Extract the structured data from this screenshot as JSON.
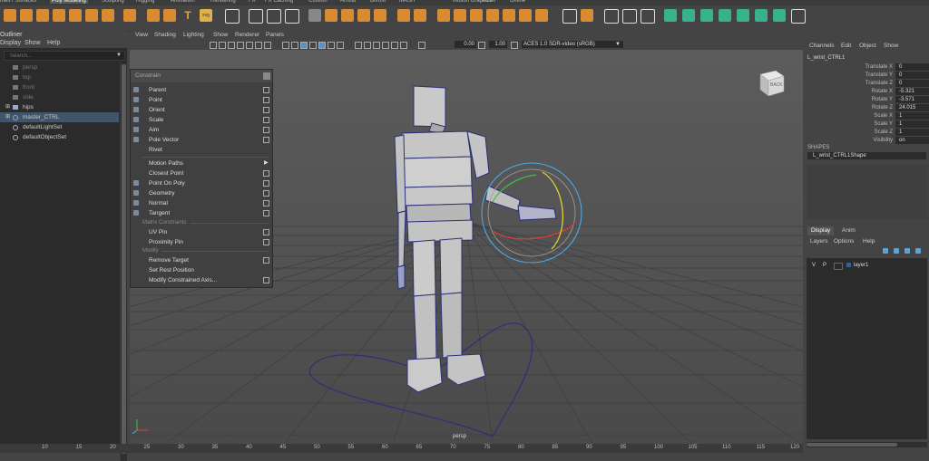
{
  "shelf_tabs": [
    "ntes / Surfaces",
    "Poly Modeling",
    "Sculpting",
    "Rigging",
    "Animation",
    "Rendering",
    "FX",
    "FX Caching",
    "Custom",
    "Arnold",
    "Bifrost",
    "MASH",
    "Motion Graphics",
    "XGen",
    "Offline"
  ],
  "shelf_active_tab": "Poly Modeling",
  "shelf_text_icons": {
    "text_tool": "T",
    "svg_tool": "svg"
  },
  "outliner": {
    "title": "Outliner",
    "menu": [
      "Display",
      "Show",
      "Help"
    ],
    "search_placeholder": "Search...",
    "items": [
      {
        "label": "persp",
        "icon": "camera-icon"
      },
      {
        "label": "top",
        "icon": "camera-icon"
      },
      {
        "label": "front",
        "icon": "camera-icon"
      },
      {
        "label": "side",
        "icon": "camera-icon"
      },
      {
        "label": "hips",
        "icon": "joint-icon"
      },
      {
        "label": "master_CTRL",
        "icon": "curve-icon"
      },
      {
        "label": "defaultLightSet",
        "icon": "set-icon"
      },
      {
        "label": "defaultObjectSet",
        "icon": "set-icon"
      }
    ],
    "selected_item": "master_CTRL"
  },
  "viewport": {
    "menu": [
      "View",
      "Shading",
      "Lighting",
      "Show",
      "Renderer",
      "Panels"
    ],
    "exposure": "0.00",
    "gamma": "1.00",
    "color_space": "ACES 1.0 SDR-video (sRGB)",
    "camera_label": "persp",
    "viewcube_face": "BACK"
  },
  "constrain_menu": {
    "title": "Constrain",
    "items": [
      {
        "label": "Parent",
        "option_box": true,
        "icon": true
      },
      {
        "label": "Point",
        "option_box": true,
        "icon": true
      },
      {
        "label": "Orient",
        "option_box": true,
        "icon": true
      },
      {
        "label": "Scale",
        "option_box": true,
        "icon": true
      },
      {
        "label": "Aim",
        "option_box": true,
        "icon": true
      },
      {
        "label": "Pole Vector",
        "option_box": true,
        "icon": true
      },
      {
        "label": "Rivet",
        "option_box": false,
        "icon": false
      },
      {
        "label": "Motion Paths",
        "submenu": true,
        "icon": false
      },
      {
        "label": "Closest Point",
        "option_box": true,
        "icon": false
      },
      {
        "label": "Point On Poly",
        "option_box": true,
        "icon": true
      },
      {
        "label": "Geometry",
        "option_box": true,
        "icon": true
      },
      {
        "label": "Normal",
        "option_box": true,
        "icon": true
      },
      {
        "label": "Tangent",
        "option_box": true,
        "icon": true
      },
      {
        "section": "Matrix Constraints"
      },
      {
        "label": "UV Pin",
        "option_box": true,
        "icon": false
      },
      {
        "label": "Proximity Pin",
        "option_box": true,
        "icon": false
      },
      {
        "section": "Modify"
      },
      {
        "label": "Remove Target",
        "option_box": true,
        "icon": false
      },
      {
        "label": "Set Rest Position",
        "option_box": false,
        "icon": false
      },
      {
        "label": "Modify Constrained Axis...",
        "option_box": true,
        "icon": false
      }
    ]
  },
  "timeline": {
    "ticks": [
      "10",
      "15",
      "20",
      "25",
      "30",
      "35",
      "40",
      "45",
      "50",
      "55",
      "60",
      "65",
      "70",
      "75",
      "80",
      "85",
      "90",
      "95",
      "100",
      "105",
      "110",
      "115",
      "120"
    ]
  },
  "channel_box": {
    "menu": [
      "Channels",
      "Edit",
      "Object",
      "Show"
    ],
    "node": "L_wrist_CTRL1",
    "attributes": [
      {
        "name": "Translate X",
        "value": "0"
      },
      {
        "name": "Translate Y",
        "value": "0"
      },
      {
        "name": "Translate Z",
        "value": "0"
      },
      {
        "name": "Rotate X",
        "value": "-5.321"
      },
      {
        "name": "Rotate Y",
        "value": "-3.571"
      },
      {
        "name": "Rotate Z",
        "value": "24.015"
      },
      {
        "name": "Scale X",
        "value": "1"
      },
      {
        "name": "Scale Y",
        "value": "1"
      },
      {
        "name": "Scale Z",
        "value": "1"
      },
      {
        "name": "Visibility",
        "value": "on"
      }
    ],
    "shapes_label": "SHAPES",
    "shape_node": "L_wrist_CTRL1Shape"
  },
  "layers": {
    "tabs": [
      "Display",
      "Anim"
    ],
    "active_tab": "Display",
    "menu": [
      "Layers",
      "Options",
      "Help"
    ],
    "rows": [
      {
        "v": "V",
        "p": "P",
        "name": "layer1"
      }
    ]
  },
  "colors": {
    "accent_selected": "#425469",
    "wire": "#2c2f7a",
    "manip_red": "#e03a3a",
    "manip_green": "#3ec23e",
    "manip_yellow": "#e0d030",
    "manip_blue": "#4aa8e8"
  }
}
